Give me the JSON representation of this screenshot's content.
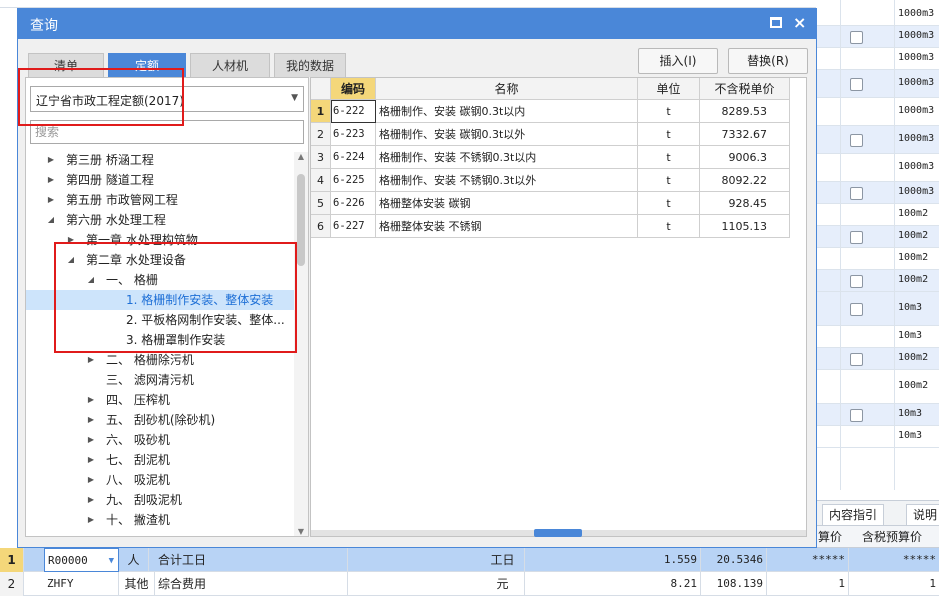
{
  "dialog": {
    "title": "查询",
    "close_label": "×"
  },
  "tabs": [
    {
      "label": "清单",
      "active": false
    },
    {
      "label": "定额",
      "active": true
    },
    {
      "label": "人材机",
      "active": false
    },
    {
      "label": "我的数据",
      "active": false
    }
  ],
  "actions": {
    "insert_label": "插入(I)",
    "replace_label": "替换(R)"
  },
  "quota_selector": {
    "value": "辽宁省市政工程定额(2017)"
  },
  "search": {
    "placeholder": "搜索"
  },
  "tree": [
    {
      "label": "第三册 桥涵工程",
      "level": 0,
      "state": "collapsed"
    },
    {
      "label": "第四册 隧道工程",
      "level": 0,
      "state": "collapsed"
    },
    {
      "label": "第五册 市政管网工程",
      "level": 0,
      "state": "collapsed"
    },
    {
      "label": "第六册 水处理工程",
      "level": 0,
      "state": "expanded"
    },
    {
      "label": "第一章 水处理构筑物",
      "level": 1,
      "state": "collapsed"
    },
    {
      "label": "第二章 水处理设备",
      "level": 1,
      "state": "expanded"
    },
    {
      "label": "一、 格栅",
      "level": 2,
      "state": "expanded"
    },
    {
      "label": "1. 格栅制作安装、整体安装",
      "level": 3,
      "state": "leaf",
      "selected": true
    },
    {
      "label": "2. 平板格网制作安装、整体...",
      "level": 3,
      "state": "leaf"
    },
    {
      "label": "3. 格栅罩制作安装",
      "level": 3,
      "state": "leaf"
    },
    {
      "label": "二、 格栅除污机",
      "level": 2,
      "state": "collapsed"
    },
    {
      "label": "三、 滤网清污机",
      "level": 2,
      "state": "none"
    },
    {
      "label": "四、 压榨机",
      "level": 2,
      "state": "collapsed"
    },
    {
      "label": "五、 刮砂机(除砂机)",
      "level": 2,
      "state": "collapsed"
    },
    {
      "label": "六、 吸砂机",
      "level": 2,
      "state": "collapsed"
    },
    {
      "label": "七、 刮泥机",
      "level": 2,
      "state": "collapsed"
    },
    {
      "label": "八、 吸泥机",
      "level": 2,
      "state": "collapsed"
    },
    {
      "label": "九、 刮吸泥机",
      "level": 2,
      "state": "collapsed"
    },
    {
      "label": "十、 撇渣机",
      "level": 2,
      "state": "collapsed"
    }
  ],
  "table": {
    "headers": [
      "编码",
      "名称",
      "单位",
      "不含税单价"
    ],
    "rows": [
      {
        "num": "1",
        "code": "6-222",
        "name": "格栅制作、安装 碳钢0.3t以内",
        "unit": "t",
        "price": "8289.53"
      },
      {
        "num": "2",
        "code": "6-223",
        "name": "格栅制作、安装 碳钢0.3t以外",
        "unit": "t",
        "price": "7332.67"
      },
      {
        "num": "3",
        "code": "6-224",
        "name": "格栅制作、安装 不锈钢0.3t以内",
        "unit": "t",
        "price": "9006.3"
      },
      {
        "num": "4",
        "code": "6-225",
        "name": "格栅制作、安装 不锈钢0.3t以外",
        "unit": "t",
        "price": "8092.22"
      },
      {
        "num": "5",
        "code": "6-226",
        "name": "格栅整体安装 碳钢",
        "unit": "t",
        "price": "928.45"
      },
      {
        "num": "6",
        "code": "6-227",
        "name": "格栅整体安装 不锈钢",
        "unit": "t",
        "price": "1105.13"
      }
    ]
  },
  "background": {
    "right_units": [
      "1000m3",
      "1000m3",
      "1000m3",
      "1000m3",
      "1000m3",
      "1000m3",
      "1000m3",
      "1000m3",
      "100m2",
      "100m2",
      "100m2",
      "100m2",
      "10m3",
      "10m3",
      "100m2",
      "100m2",
      "10m3",
      "10m3"
    ],
    "lower_tabs": [
      "内容指引",
      "说明"
    ],
    "lower_headers": [
      "算价",
      "含税预算价"
    ],
    "bottom_rows": [
      {
        "num": "1",
        "code": "R00000",
        "type": "人",
        "name": "合计工日",
        "unit": "工日",
        "qty": "1.559",
        "price": "20.5346",
        "c1": "*****",
        "c2": "*****"
      },
      {
        "num": "2",
        "code": "ZHFY",
        "type": "其他",
        "name": "综合费用",
        "unit": "元",
        "qty": "8.21",
        "price": "108.139",
        "c1": "1",
        "c2": "1"
      }
    ]
  }
}
